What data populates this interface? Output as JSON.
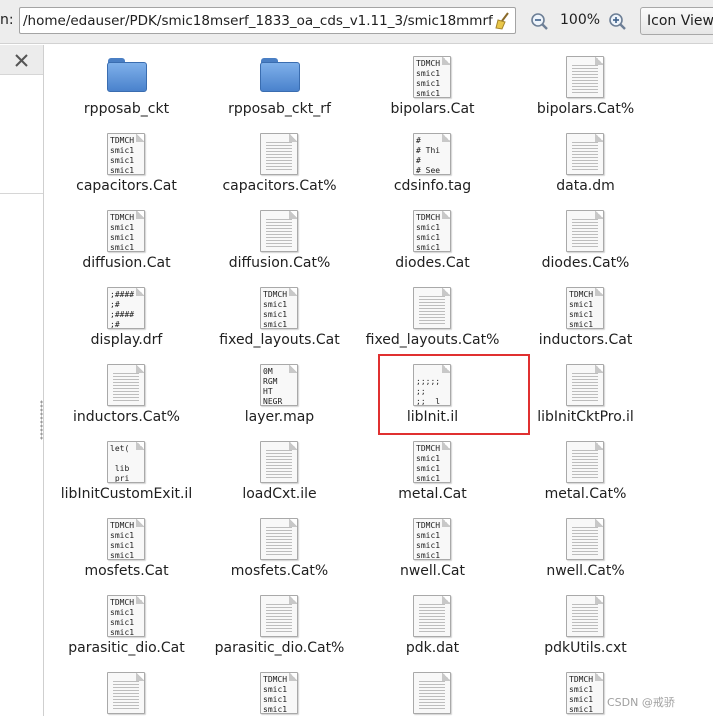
{
  "toolbar": {
    "location_label": "n:",
    "location_value": "/home/edauser/PDK/smic18mserf_1833_oa_cds_v1.11_3/smic18mmrf",
    "zoom_level": "100%",
    "view_mode": "Icon View"
  },
  "files": [
    {
      "name": "rpposab_ckt",
      "type": "folder"
    },
    {
      "name": "rpposab_ckt_rf",
      "type": "folder"
    },
    {
      "name": "bipolars.Cat",
      "type": "preview",
      "preview": "TDMCH\nsmic1\nsmic1\nsmic1"
    },
    {
      "name": "bipolars.Cat%",
      "type": "doc"
    },
    {
      "name": "capacitors.Cat",
      "type": "preview",
      "preview": "TDMCH\nsmic1\nsmic1\nsmic1"
    },
    {
      "name": "capacitors.Cat%",
      "type": "doc"
    },
    {
      "name": "cdsinfo.tag",
      "type": "preview",
      "preview": "#\n# Thi\n#\n# See"
    },
    {
      "name": "data.dm",
      "type": "doc"
    },
    {
      "name": "diffusion.Cat",
      "type": "preview",
      "preview": "TDMCH\nsmic1\nsmic1\nsmic1"
    },
    {
      "name": "diffusion.Cat%",
      "type": "doc"
    },
    {
      "name": "diodes.Cat",
      "type": "preview",
      "preview": "TDMCH\nsmic1\nsmic1\nsmic1"
    },
    {
      "name": "diodes.Cat%",
      "type": "doc"
    },
    {
      "name": "display.drf",
      "type": "preview",
      "preview": ";####\n;#\n;####\n;#"
    },
    {
      "name": "fixed_layouts.Cat",
      "type": "preview",
      "preview": "TDMCH\nsmic1\nsmic1\nsmic1"
    },
    {
      "name": "fixed_layouts.Cat%",
      "type": "doc"
    },
    {
      "name": "inductors.Cat",
      "type": "preview",
      "preview": "TDMCH\nsmic1\nsmic1\nsmic1"
    },
    {
      "name": "inductors.Cat%",
      "type": "doc"
    },
    {
      "name": "layer.map",
      "type": "preview",
      "preview": "0M\nRGM\nHT\nNEGR"
    },
    {
      "name": "libInit.il",
      "type": "preview",
      "preview": "\n;;;;;\n;;\n;;  l"
    },
    {
      "name": "libInitCktPro.il",
      "type": "doc"
    },
    {
      "name": "libInitCustomExit.il",
      "type": "preview",
      "preview": "let(\n\n lib\n pri"
    },
    {
      "name": "loadCxt.ile",
      "type": "doc"
    },
    {
      "name": "metal.Cat",
      "type": "preview",
      "preview": "TDMCH\nsmic1\nsmic1\nsmic1"
    },
    {
      "name": "metal.Cat%",
      "type": "doc"
    },
    {
      "name": "mosfets.Cat",
      "type": "preview",
      "preview": "TDMCH\nsmic1\nsmic1\nsmic1"
    },
    {
      "name": "mosfets.Cat%",
      "type": "doc"
    },
    {
      "name": "nwell.Cat",
      "type": "preview",
      "preview": "TDMCH\nsmic1\nsmic1\nsmic1"
    },
    {
      "name": "nwell.Cat%",
      "type": "doc"
    },
    {
      "name": "parasitic_dio.Cat",
      "type": "preview",
      "preview": "TDMCH\nsmic1\nsmic1\nsmic1"
    },
    {
      "name": "parasitic_dio.Cat%",
      "type": "doc"
    },
    {
      "name": "pdk.dat",
      "type": "doc"
    },
    {
      "name": "pdkUtils.cxt",
      "type": "doc"
    },
    {
      "name": "",
      "type": "doc"
    },
    {
      "name": "",
      "type": "preview",
      "preview": "TDMCH\nsmic1\nsmic1\nsmic1"
    },
    {
      "name": "",
      "type": "doc"
    },
    {
      "name": "",
      "type": "preview",
      "preview": "TDMCH\nsmic1\nsmic1\nsmic1"
    }
  ],
  "watermark": "CSDN @戒骄",
  "colors": {
    "highlight": "#e03030",
    "folder": "#4a82cc"
  }
}
